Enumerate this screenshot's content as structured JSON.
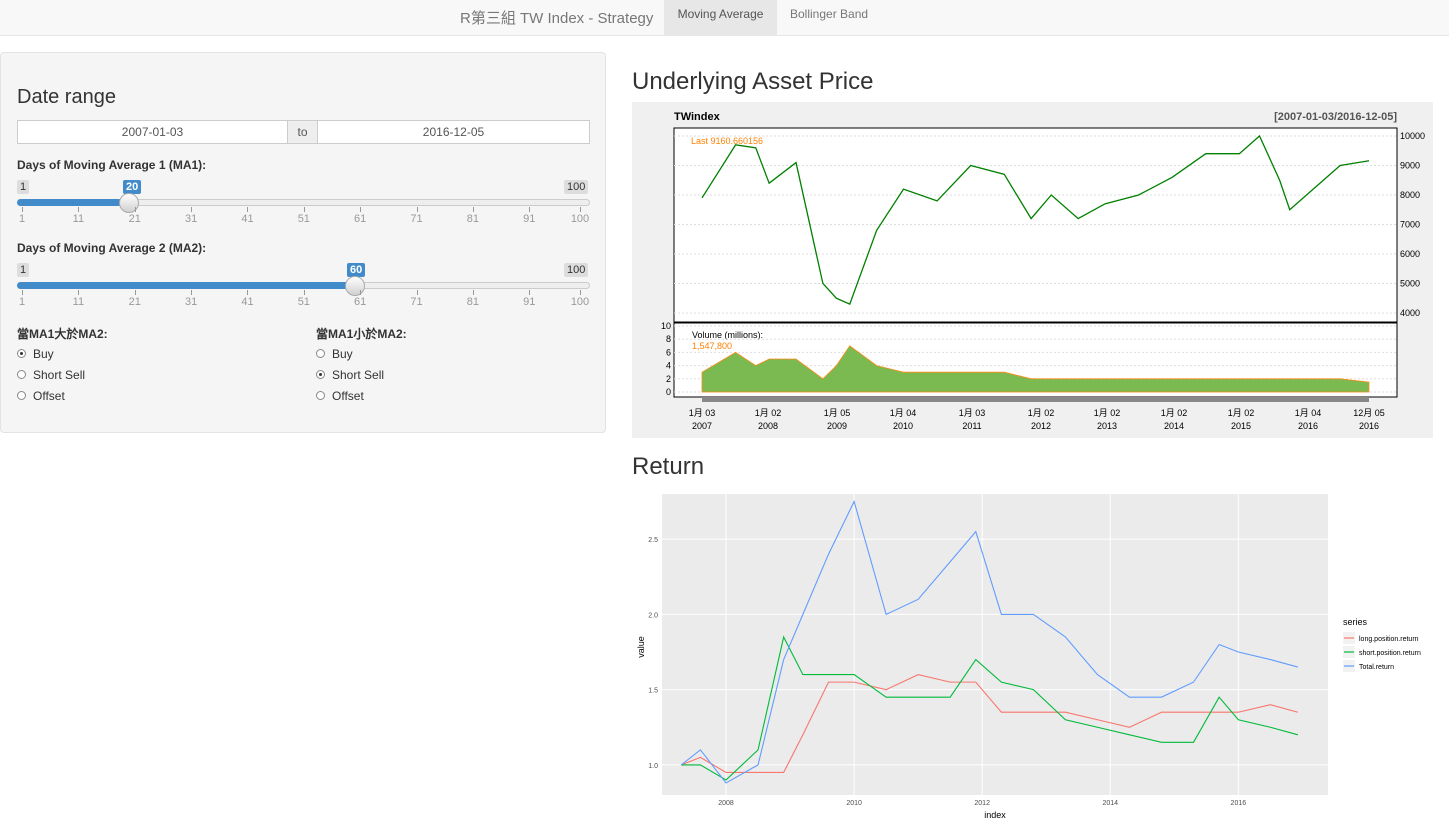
{
  "nav": {
    "brand": "R第三組 TW Index - Strategy",
    "tabs": [
      {
        "label": "Moving Average",
        "active": true
      },
      {
        "label": "Bollinger Band",
        "active": false
      }
    ]
  },
  "sidebar": {
    "date_range": {
      "title": "Date range",
      "start": "2007-01-03",
      "separator": "to",
      "end": "2016-12-05"
    },
    "ma1": {
      "label": "Days of Moving Average 1 (MA1):",
      "min": "1",
      "max": "100",
      "value": "20",
      "ticks": [
        "1",
        "11",
        "21",
        "31",
        "41",
        "51",
        "61",
        "71",
        "81",
        "91",
        "100"
      ]
    },
    "ma2": {
      "label": "Days of Moving Average 2 (MA2):",
      "min": "1",
      "max": "100",
      "value": "60",
      "ticks": [
        "1",
        "11",
        "21",
        "31",
        "41",
        "51",
        "61",
        "71",
        "81",
        "91",
        "100"
      ]
    },
    "when_above": {
      "label": "當MA1大於MA2:",
      "options": [
        "Buy",
        "Short Sell",
        "Offset"
      ],
      "selected": 0
    },
    "when_below": {
      "label": "當MA1小於MA2:",
      "options": [
        "Buy",
        "Short Sell",
        "Offset"
      ],
      "selected": 1
    }
  },
  "main": {
    "price_title": "Underlying Asset Price",
    "return_title": "Return"
  },
  "colors": {
    "accent": "#428bca",
    "long": "#f8766d",
    "short": "#00ba38",
    "total": "#619cff",
    "price_up": "#008000",
    "price_down": "#ff8000"
  },
  "chart_data": [
    {
      "type": "line",
      "title": "TWindex",
      "subtitle": "[2007-01-03/2016-12-05]",
      "last_label": "Last 9160.660156",
      "volume_label": "Volume (millions):",
      "volume_last": "1,547,800",
      "y_ticks": [
        "10000",
        "9000",
        "8000",
        "7000",
        "6000",
        "5000",
        "4000"
      ],
      "volume_ticks": [
        "10",
        "8",
        "6",
        "4",
        "2",
        "0"
      ],
      "x_ticks": [
        {
          "m": "1月 03",
          "y": "2007"
        },
        {
          "m": "1月 02",
          "y": "2008"
        },
        {
          "m": "1月 05",
          "y": "2009"
        },
        {
          "m": "1月 04",
          "y": "2010"
        },
        {
          "m": "1月 03",
          "y": "2011"
        },
        {
          "m": "1月 02",
          "y": "2012"
        },
        {
          "m": "1月 02",
          "y": "2013"
        },
        {
          "m": "1月 02",
          "y": "2014"
        },
        {
          "m": "1月 02",
          "y": "2015"
        },
        {
          "m": "1月 04",
          "y": "2016"
        },
        {
          "m": "12月 05",
          "y": "2016"
        }
      ],
      "x": [
        2007.0,
        2007.5,
        2007.8,
        2008.0,
        2008.4,
        2008.8,
        2009.0,
        2009.2,
        2009.6,
        2010.0,
        2010.5,
        2011.0,
        2011.5,
        2011.9,
        2012.2,
        2012.6,
        2013.0,
        2013.5,
        2014.0,
        2014.5,
        2015.0,
        2015.3,
        2015.6,
        2015.75,
        2016.0,
        2016.5,
        2016.93
      ],
      "y": [
        7900,
        9700,
        9600,
        8400,
        9100,
        5000,
        4500,
        4300,
        6800,
        8200,
        7800,
        9000,
        8700,
        7200,
        8000,
        7200,
        7700,
        8000,
        8600,
        9400,
        9400,
        10000,
        8500,
        7500,
        8000,
        9000,
        9160
      ],
      "volume": [
        3,
        6,
        4,
        5,
        5,
        2,
        4,
        7,
        4,
        3,
        3,
        3,
        3,
        2,
        2,
        2,
        2,
        2,
        2,
        2,
        2,
        2,
        2,
        2,
        2,
        2,
        1.5
      ]
    },
    {
      "type": "line",
      "xlabel": "index",
      "ylabel": "value",
      "legend_title": "series",
      "legend_position": "right",
      "x_ticks": [
        "2008",
        "2010",
        "2012",
        "2014",
        "2016"
      ],
      "y_ticks": [
        "1.0",
        "1.5",
        "2.0",
        "2.5"
      ],
      "xlim": [
        2007.0,
        2017.4
      ],
      "ylim": [
        0.8,
        2.8
      ],
      "grid": true,
      "x": [
        2007.3,
        2007.6,
        2008.0,
        2008.5,
        2008.9,
        2009.2,
        2009.6,
        2010.0,
        2010.5,
        2011.0,
        2011.5,
        2011.9,
        2012.3,
        2012.8,
        2013.3,
        2013.8,
        2014.3,
        2014.8,
        2015.3,
        2015.7,
        2016.0,
        2016.5,
        2016.93
      ],
      "series": [
        {
          "name": "long.position.return",
          "values": [
            1.0,
            1.05,
            0.95,
            0.95,
            0.95,
            1.2,
            1.55,
            1.55,
            1.5,
            1.6,
            1.55,
            1.55,
            1.35,
            1.35,
            1.35,
            1.3,
            1.25,
            1.35,
            1.35,
            1.35,
            1.35,
            1.4,
            1.35
          ]
        },
        {
          "name": "short.position.return",
          "values": [
            1.0,
            1.0,
            0.9,
            1.1,
            1.85,
            1.6,
            1.6,
            1.6,
            1.45,
            1.45,
            1.45,
            1.7,
            1.55,
            1.5,
            1.3,
            1.25,
            1.2,
            1.15,
            1.15,
            1.45,
            1.3,
            1.25,
            1.2
          ]
        },
        {
          "name": "Total.return",
          "values": [
            1.0,
            1.1,
            0.88,
            1.0,
            1.7,
            2.0,
            2.4,
            2.75,
            2.0,
            2.1,
            2.35,
            2.55,
            2.0,
            2.0,
            1.85,
            1.6,
            1.45,
            1.45,
            1.55,
            1.8,
            1.75,
            1.7,
            1.65
          ]
        }
      ]
    }
  ]
}
